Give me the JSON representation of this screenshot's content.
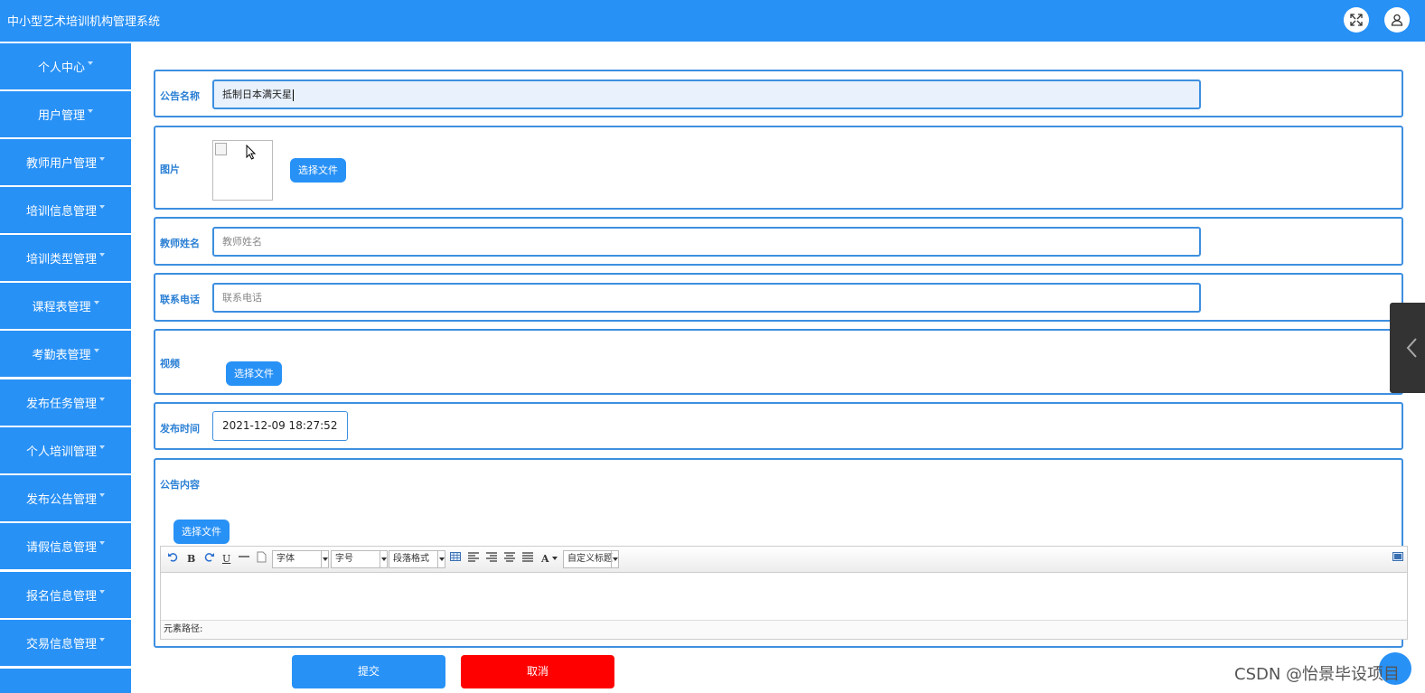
{
  "header": {
    "title": "中小型艺术培训机构管理系统",
    "fullscreen_icon": "fullscreen-icon",
    "user_icon": "user-icon",
    "color": "#2891f6"
  },
  "sidebar": {
    "items": [
      {
        "label": "个人中心"
      },
      {
        "label": "用户管理"
      },
      {
        "label": "教师用户管理"
      },
      {
        "label": "培训信息管理"
      },
      {
        "label": "培训类型管理"
      },
      {
        "label": "课程表管理"
      },
      {
        "label": "考勤表管理"
      },
      {
        "label": "发布任务管理"
      },
      {
        "label": "个人培训管理"
      },
      {
        "label": "发布公告管理"
      },
      {
        "label": "请假信息管理"
      },
      {
        "label": "报名信息管理"
      },
      {
        "label": "交易信息管理"
      }
    ]
  },
  "form": {
    "title_label": "公告名称",
    "title_value": "抵制日本满天星",
    "image_label": "图片",
    "image_button": "选择文件",
    "teacher_label": "教师姓名",
    "teacher_placeholder": "教师姓名",
    "phone_label": "联系电话",
    "phone_placeholder": "联系电话",
    "video_label": "视频",
    "video_button": "选择文件",
    "time_label": "发布时间",
    "time_value": "2021-12-09 18:27:52",
    "content_label": "公告内容",
    "content_button": "选择文件"
  },
  "editor": {
    "font_select": "字体",
    "size_select": "字号",
    "paragraph_select": "段落格式",
    "custom_title_select": "自定义标题",
    "font_color_glyph": "A",
    "bold_glyph": "B",
    "underline_glyph": "U",
    "path_label": "元素路径:"
  },
  "actions": {
    "submit": "提交",
    "cancel": "取消",
    "submit_color": "#2891f6",
    "cancel_color": "#ff0000"
  },
  "watermark": "CSDN @怡景毕设项目"
}
